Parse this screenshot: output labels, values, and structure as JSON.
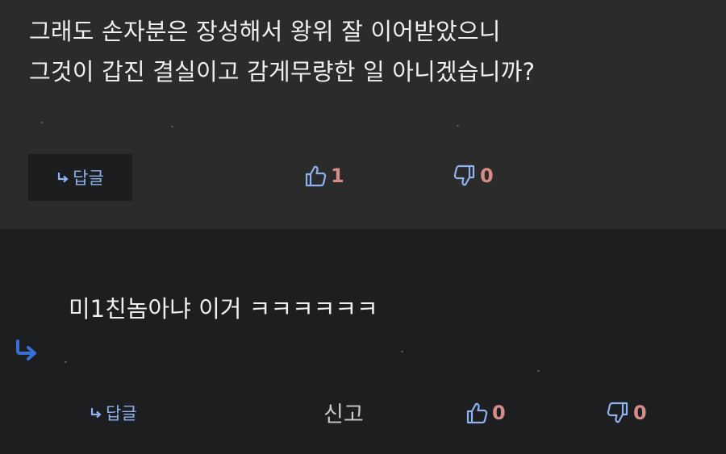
{
  "comment1": {
    "lines": [
      "그래도 손자분은 장성해서 왕위 잘 이어받았으니",
      "그것이 갑진 결실이고 감게무량한 일 아니겠습니까?"
    ],
    "reply_label": "답글",
    "likes": "1",
    "dislikes": "0"
  },
  "comment2": {
    "text": "미1친놈아냐 이거 ㅋㅋㅋㅋㅋㅋ",
    "reply_label": "답글",
    "report_label": "신고",
    "likes": "0",
    "dislikes": "0"
  },
  "colors": {
    "accent_blue": "#8fb2ef",
    "count_red": "#d98b88",
    "nested_arrow_blue": "#3a6fd8"
  },
  "icons": {
    "reply": "reply-arrow-icon",
    "like": "thumbs-up-icon",
    "dislike": "thumbs-down-icon",
    "nested": "nested-reply-arrow-icon"
  }
}
